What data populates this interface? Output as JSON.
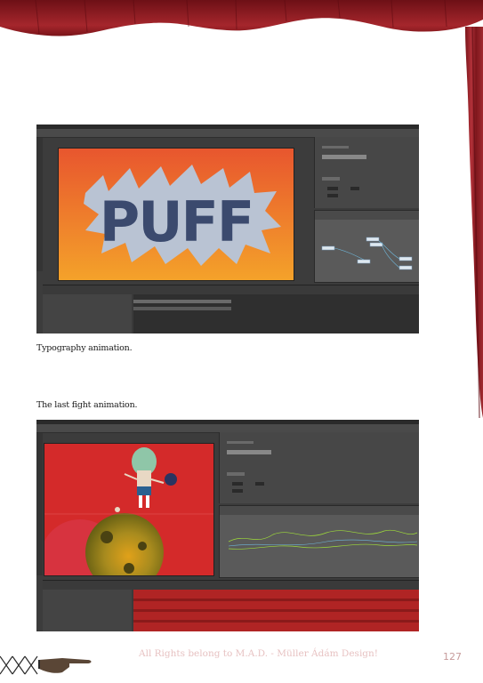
{
  "screenshots": [
    {
      "caption": "Typography animation.",
      "stage_text": "PUFF",
      "colors": {
        "stage_top": "#e8562e",
        "stage_bottom": "#f4a22a",
        "text": "#3b4a6e",
        "burst": "#b9c3d3"
      }
    },
    {
      "caption": "The last fight animation.",
      "colors": {
        "stage": "#d42a2a",
        "planet": "#8a7d1e",
        "timeline_track": "#b02424"
      }
    }
  ],
  "footer": {
    "credit": "All Rights belong to M.A.D. - Müller Ádám Design!",
    "page_number": "127"
  },
  "colors": {
    "curtain": "#8e1c22",
    "curtain_dark": "#5e0c12",
    "page": "#ffffff"
  },
  "icons": [
    "curtain-valance",
    "side-curtain",
    "pointing-hand-ornament"
  ]
}
